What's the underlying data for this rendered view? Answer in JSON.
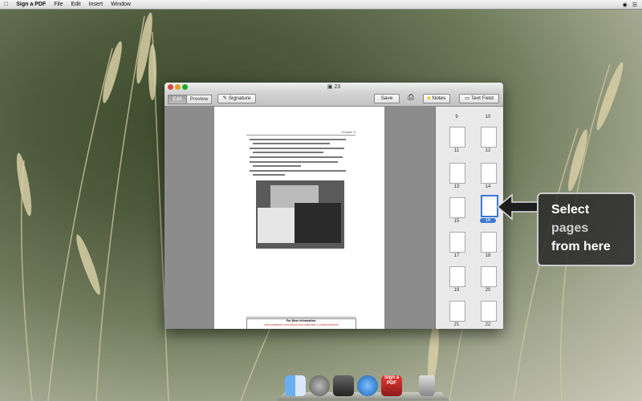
{
  "menubar": {
    "apple": "",
    "app_name": "Sign a PDF",
    "menus": [
      "File",
      "Edit",
      "Insert",
      "Window"
    ]
  },
  "window": {
    "title": "23",
    "toolbar": {
      "edit_label": "Edit",
      "preview_label": "Preview",
      "signature_label": "Signature",
      "save_label": "Save",
      "notes_label": "Notes",
      "text_field_label": "Text Field"
    },
    "document": {
      "header_right": "Chapter 3",
      "footer_title": "For More Information:",
      "footer_link": "www.packtpub.com/cocoa-and-objective-c-cookbook/book"
    },
    "thumbnails": {
      "page_numbers": [
        "9",
        "10",
        "11",
        "12",
        "13",
        "14",
        "15",
        "16",
        "17",
        "18",
        "19",
        "20",
        "21",
        "22"
      ],
      "selected": "16"
    }
  },
  "callout": {
    "line1": "Select",
    "line2": "pages",
    "line3": "from here"
  },
  "colors": {
    "selection": "#3a78d6",
    "callout_bg": "#232323",
    "callout_pages_text": "#cfcfcf"
  }
}
